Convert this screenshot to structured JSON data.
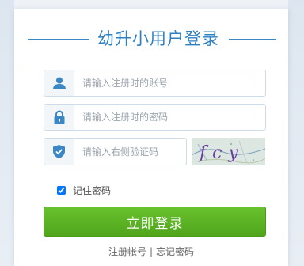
{
  "title": "幼升小用户登录",
  "username": {
    "placeholder": "请输入注册时的账号",
    "icon": "user-icon"
  },
  "password": {
    "placeholder": "请输入注册时的密码",
    "icon": "lock-icon"
  },
  "captcha_input": {
    "placeholder": "请输入右侧验证码",
    "icon": "shield-icon"
  },
  "captcha_text": "fcy",
  "remember": {
    "label": "记住密码",
    "checked": true
  },
  "login_button": "立即登录",
  "links": {
    "register": "注册帐号",
    "separator": "|",
    "forgot": "忘记密码"
  },
  "colors": {
    "accent": "#2f80c2",
    "button": "#5cb322",
    "icon": "#3b86c4"
  }
}
